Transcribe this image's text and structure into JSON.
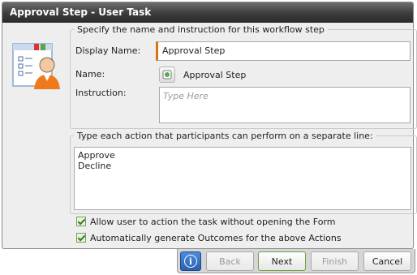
{
  "window": {
    "title": "Approval Step - User Task"
  },
  "step_section": {
    "legend": "Specify the name and instruction for this workflow step",
    "display_name_label": "Display Name:",
    "display_name_value": "Approval Step",
    "name_label": "Name:",
    "name_value": "Approval Step",
    "instruction_label": "Instruction:",
    "instruction_placeholder": "Type Here"
  },
  "actions_section": {
    "legend": "Type each action that participants can perform on a separate line:",
    "actions": [
      "Approve",
      "Decline"
    ]
  },
  "options": [
    {
      "label": "Allow user to action the task without opening the Form",
      "checked": true
    },
    {
      "label": "Automatically generate Outcomes for the above Actions",
      "checked": true
    }
  ],
  "buttons": {
    "info": "i",
    "back": "Back",
    "next": "Next",
    "finish": "Finish",
    "cancel": "Cancel"
  },
  "colors": {
    "accent": "#d9741a",
    "check": "#3a7d1f",
    "info_button": "#2a5fb0"
  }
}
